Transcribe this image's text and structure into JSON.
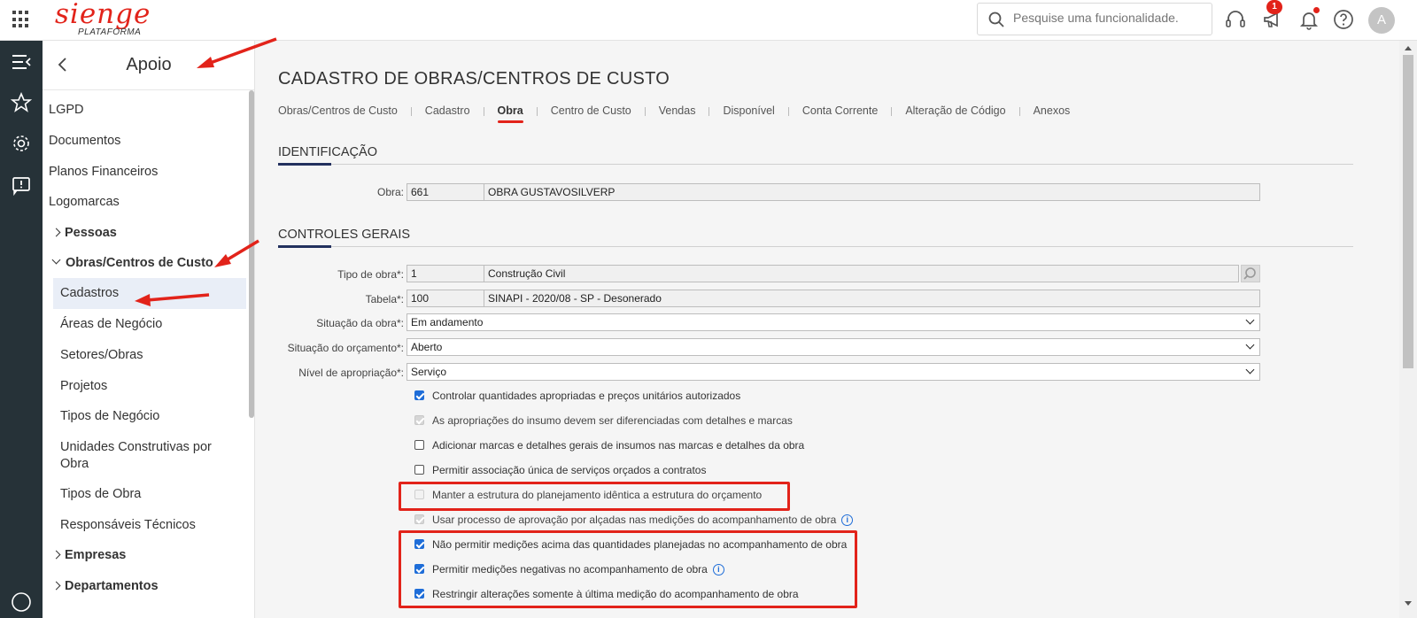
{
  "header": {
    "logo_text": "sienge",
    "logo_sub": "PLATAFORMA",
    "search_placeholder": "Pesquise uma funcionalidade.",
    "notification_count": "1",
    "avatar_initial": "A"
  },
  "sidebar": {
    "title": "Apoio",
    "items": [
      {
        "label": "LGPD"
      },
      {
        "label": "Documentos"
      },
      {
        "label": "Planos Financeiros"
      },
      {
        "label": "Logomarcas"
      },
      {
        "label": "Pessoas"
      },
      {
        "label": "Obras/Centros de Custo"
      },
      {
        "label": "Cadastros"
      },
      {
        "label": "Áreas de Negócio"
      },
      {
        "label": "Setores/Obras"
      },
      {
        "label": "Projetos"
      },
      {
        "label": "Tipos de Negócio"
      },
      {
        "label": "Unidades Construtivas por"
      },
      {
        "label": "Obra"
      },
      {
        "label": "Tipos de Obra"
      },
      {
        "label": "Responsáveis Técnicos"
      },
      {
        "label": "Empresas"
      },
      {
        "label": "Departamentos"
      }
    ]
  },
  "main": {
    "title": "CADASTRO DE OBRAS/CENTROS DE CUSTO",
    "tabs": [
      {
        "label": "Obras/Centros de Custo"
      },
      {
        "label": "Cadastro"
      },
      {
        "label": "Obra"
      },
      {
        "label": "Centro de Custo"
      },
      {
        "label": "Vendas"
      },
      {
        "label": "Disponível"
      },
      {
        "label": "Conta Corrente"
      },
      {
        "label": "Alteração de Código"
      },
      {
        "label": "Anexos"
      }
    ],
    "identificacao": {
      "section_title": "IDENTIFICAÇÃO",
      "obra_label": "Obra:",
      "obra_code": "661",
      "obra_name": "OBRA GUSTAVOSILVERP"
    },
    "controles": {
      "section_title": "CONTROLES GERAIS",
      "tipo_obra_label": "Tipo de obra*:",
      "tipo_obra_code": "1",
      "tipo_obra_name": "Construção Civil",
      "tabela_label": "Tabela*:",
      "tabela_code": "100",
      "tabela_name": "SINAPI - 2020/08 - SP - Desonerado",
      "situacao_obra_label": "Situação da obra*:",
      "situacao_obra_value": "Em andamento",
      "situacao_orcamento_label": "Situação do orçamento*:",
      "situacao_orcamento_value": "Aberto",
      "nivel_label": "Nível de apropriação*:",
      "nivel_value": "Serviço",
      "checkboxes": [
        {
          "label": "Controlar quantidades apropriadas e preços unitários autorizados",
          "checked": true,
          "disabled": false
        },
        {
          "label": "As apropriações do insumo devem ser diferenciadas com detalhes e marcas",
          "checked": true,
          "disabled": true
        },
        {
          "label": "Adicionar marcas e detalhes gerais de insumos nas marcas e detalhes da obra",
          "checked": false,
          "disabled": false
        },
        {
          "label": "Permitir associação única de serviços orçados a contratos",
          "checked": false,
          "disabled": false
        },
        {
          "label": "Manter a estrutura do planejamento idêntica a estrutura do orçamento",
          "checked": false,
          "disabled": true
        },
        {
          "label": "Usar processo de aprovação por alçadas nas medições do acompanhamento de obra",
          "checked": true,
          "disabled": true
        },
        {
          "label": "Não permitir medições acima das quantidades planejadas no acompanhamento de obra",
          "checked": true,
          "disabled": false
        },
        {
          "label": "Permitir medições negativas no acompanhamento de obra",
          "checked": true,
          "disabled": false
        },
        {
          "label": "Restringir alterações somente à última medição do acompanhamento de obra",
          "checked": true,
          "disabled": false
        }
      ]
    }
  },
  "colors": {
    "brand_red": "#e2231a",
    "rail_bg": "#263238",
    "section_accent": "#22305e",
    "checkbox_blue": "#1e6dd8"
  }
}
